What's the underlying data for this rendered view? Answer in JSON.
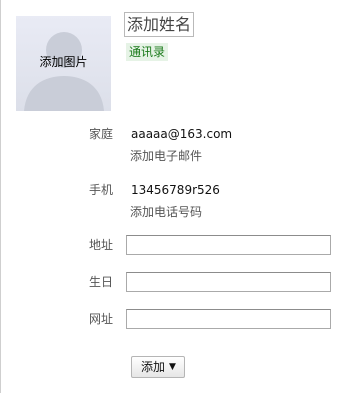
{
  "photo": {
    "label": "添加图片",
    "icon": "person-silhouette-icon"
  },
  "name": {
    "placeholder": "添加姓名"
  },
  "group": {
    "label": "通讯录"
  },
  "email": {
    "label": "家庭",
    "value": "aaaaa@163.com",
    "add_label": "添加电子邮件"
  },
  "phone": {
    "label": "手机",
    "value": "13456789r526",
    "add_label": "添加电话号码"
  },
  "address": {
    "label": "地址",
    "value": ""
  },
  "birthday": {
    "label": "生日",
    "value": ""
  },
  "website": {
    "label": "网址",
    "value": ""
  },
  "add_button": {
    "label": "添加",
    "caret": "▼"
  },
  "colors": {
    "tag_bg": "#e6f3e6",
    "tag_text": "#1a7a1a"
  }
}
